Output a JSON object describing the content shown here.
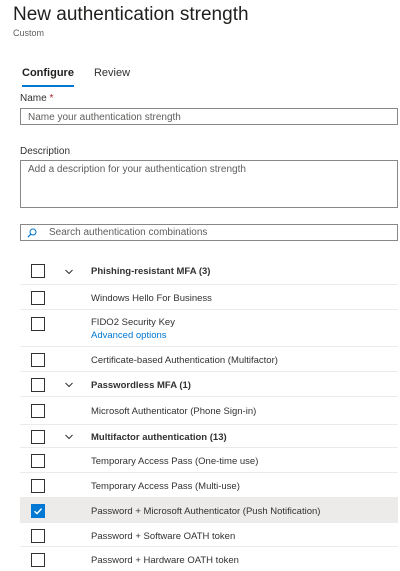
{
  "header": {
    "title": "New authentication strength",
    "subtitle": "Custom"
  },
  "tabs": [
    {
      "label": "Configure"
    },
    {
      "label": "Review"
    }
  ],
  "form": {
    "name_label": "Name",
    "required_marker": "*",
    "name_placeholder": "Name your authentication strength",
    "description_label": "Description",
    "description_placeholder": "Add a description for your authentication strength"
  },
  "search": {
    "placeholder": "Search authentication combinations"
  },
  "list": {
    "groups": [
      {
        "label": "Phishing-resistant MFA (3)",
        "items": [
          {
            "label": "Windows Hello For Business",
            "checked": false
          },
          {
            "label": "FIDO2 Security Key",
            "link": "Advanced options",
            "checked": false
          },
          {
            "label": "Certificate-based Authentication (Multifactor)",
            "checked": false
          }
        ]
      },
      {
        "label": "Passwordless MFA (1)",
        "items": [
          {
            "label": "Microsoft Authenticator (Phone Sign-in)",
            "checked": false
          }
        ]
      },
      {
        "label": "Multifactor authentication (13)",
        "items": [
          {
            "label": "Temporary Access Pass (One-time use)",
            "checked": false
          },
          {
            "label": "Temporary Access Pass (Multi-use)",
            "checked": false
          },
          {
            "label": "Password + Microsoft Authenticator (Push Notification)",
            "checked": true
          },
          {
            "label": "Password + Software OATH token",
            "checked": false
          },
          {
            "label": "Password + Hardware OATH token",
            "checked": false
          }
        ]
      }
    ]
  },
  "colors": {
    "accent": "#0078d4",
    "selected_row": "#edebe9",
    "required": "#a4262c"
  }
}
